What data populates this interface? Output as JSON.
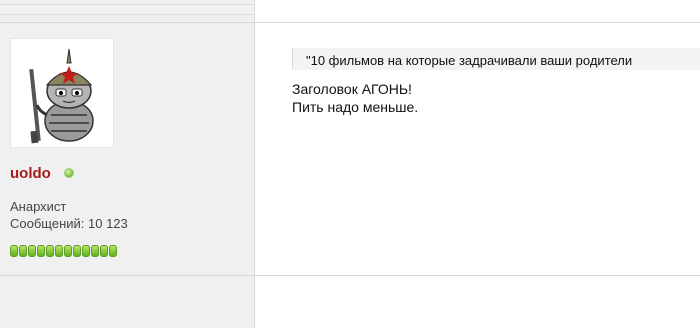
{
  "author": {
    "username": "uoldo",
    "status": "online",
    "rank": "Анархист",
    "posts_label": "Сообщений: 10 123",
    "reputation_pips": 12,
    "avatar_icon": "cat-soldier-avatar"
  },
  "post": {
    "quote": "\"10 фильмов на которые задрачивали ваши родители",
    "lines": [
      "Заголовок АГОНЬ!",
      "Пить надо меньше."
    ]
  },
  "colors": {
    "username": "#a21d1d",
    "online": "#6cc13a",
    "panel": "#f0f0f0"
  }
}
